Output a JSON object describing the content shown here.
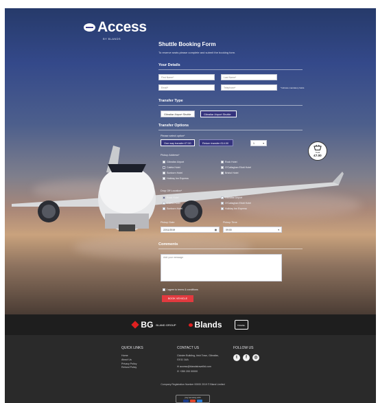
{
  "brand": {
    "name": "Access",
    "sub": "BY BLANDS"
  },
  "form": {
    "title": "Shuttle Booking Form",
    "subtitle": "To reserve seats please complete and submit the booking form.",
    "your_details": {
      "heading": "Your Details",
      "first_name_placeholder": "First Name*",
      "last_name_placeholder": "Last Name*",
      "email_placeholder": "Email*",
      "telephone_placeholder": "Telephone*",
      "required_note": "*indicate mandatory fields"
    },
    "transfer_type": {
      "heading": "Transfer Type",
      "option_to_airport": "Gibraltar Airport Shuttle",
      "option_from_airport": "Gibraltar Airport Shuttle"
    },
    "transfer_options": {
      "heading": "Transfer Options",
      "select_label": "Please select option*",
      "option_one_way": "One way transfer £7.00",
      "option_return": "Return transfer £14.00",
      "passengers_value": "1"
    },
    "pickup": {
      "label": "Pickup Address*",
      "items": [
        {
          "label": "Gibraltar Airport",
          "checked": false
        },
        {
          "label": "Rock Hotel",
          "checked": false
        },
        {
          "label": "Caleta Hotel",
          "checked": true
        },
        {
          "label": "O'Callaghan Eliott Hotel",
          "checked": false
        },
        {
          "label": "Sunborn Hotel",
          "checked": false
        },
        {
          "label": "Bristol Hotel",
          "checked": false
        },
        {
          "label": "Holiday Inn Express",
          "checked": false
        }
      ]
    },
    "dropoff": {
      "label": "Drop Off Location*",
      "items": [
        {
          "label": "Rock Hotel",
          "checked": true
        },
        {
          "label": "Gibraltar Airport",
          "checked": false
        },
        {
          "label": "Caleta Hotel",
          "checked": false
        },
        {
          "label": "O'Callaghan Eliott Hotel",
          "checked": false
        },
        {
          "label": "Sunborn Hotel",
          "checked": false
        },
        {
          "label": "Holiday Inn Express",
          "checked": false
        }
      ]
    },
    "pickup_date": {
      "label": "Pickup Date",
      "value": "22/11/2019"
    },
    "pickup_time": {
      "label": "Pickup Time",
      "value": "09:00"
    },
    "comments": {
      "heading": "Comments",
      "placeholder": "Add your message"
    },
    "terms_label": "I agree to terms & conditions",
    "submit_label": "BOOK VEHICLE"
  },
  "basket": {
    "label": "Total",
    "amount": "£7.00"
  },
  "partners": {
    "bg": "BG",
    "bg_side": "BLAND GROUP",
    "blands": "Blands",
    "third": "TRAVEL"
  },
  "footer": {
    "quick_links": {
      "heading": "QUICK LINKS",
      "items": [
        "Home",
        "About Us",
        "Privacy Policy",
        "Refund Policy"
      ]
    },
    "contact": {
      "heading": "CONTACT US",
      "address": "Cloister Building, Irish Town, Gibraltar, GX11 1AA",
      "email": "access@blandstravelltd.com",
      "phone": "+350 200 00000"
    },
    "follow": {
      "heading": "FOLLOW US"
    },
    "registration": "Company Registration Number 00000  2019 © Bland Limited",
    "pay_label": "pay securely with"
  },
  "colors": {
    "accent": "#34337d",
    "submit": "#e23a3f",
    "footer": "#2a2a2a"
  }
}
